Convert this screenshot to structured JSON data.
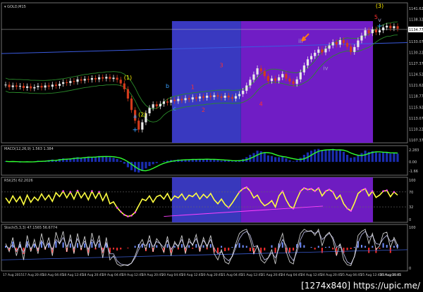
{
  "window": {
    "symbol_label": "GOLD,M15"
  },
  "colors": {
    "bg": "#000000",
    "border": "#8a8a8a",
    "bull": "#e8e8e8",
    "bear": "#d23a1c",
    "blue_zone": "#3e3ed0",
    "purple_zone": "#7a1fd6",
    "ma": "#2a8a2a",
    "trend": "#3b5be0",
    "macd_hist": "#1a2db0",
    "macd_line": "#30ff30",
    "rsi": "#ffff40",
    "rsi_dot": "#ff40ff",
    "stoch_blue": "#6f8cff",
    "stoch_red": "#ff3030",
    "axis_text": "#cfcfcf",
    "wave_yellow": "#ffee00",
    "wave_blue": "#3aa0ff",
    "wave_red": "#ff3030",
    "wave_grey": "#a0a0c8",
    "arrow": "#ff7a1a"
  },
  "chart_data": [
    {
      "type": "candlestick",
      "title": "GOLD,M15",
      "ylim": [
        1107.37,
        1141.62
      ],
      "y_ticks": [
        "1141.62",
        "1138.32",
        "1135.97",
        "1133.07",
        "1130.22",
        "1127.37",
        "1124.52",
        "1121.62",
        "1118.77",
        "1115.92",
        "1113.07",
        "1110.22",
        "1107.37"
      ],
      "current_price": "1134.77",
      "zones": [
        {
          "from_bar": 0.42,
          "to_bar": 0.59,
          "color": "blue"
        },
        {
          "from_bar": 0.59,
          "to_bar": 0.915,
          "color": "purple"
        }
      ],
      "close": [
        1121.6,
        1121.0,
        1121.4,
        1121.1,
        1121.3,
        1120.8,
        1121.2,
        1120.7,
        1121.0,
        1121.3,
        1120.9,
        1121.4,
        1121.1,
        1121.6,
        1121.3,
        1121.8,
        1122.2,
        1122.0,
        1122.5,
        1122.3,
        1122.9,
        1122.6,
        1123.0,
        1122.8,
        1123.2,
        1122.9,
        1123.4,
        1123.1,
        1123.5,
        1123.0,
        1123.3,
        1122.8,
        1121.9,
        1120.5,
        1118.2,
        1115.4,
        1112.8,
        1110.6,
        1112.4,
        1114.6,
        1115.9,
        1116.8,
        1116.3,
        1116.9,
        1117.5,
        1117.2,
        1117.9,
        1117.6,
        1118.1,
        1117.8,
        1118.3,
        1118.0,
        1118.5,
        1118.2,
        1118.7,
        1118.4,
        1118.9,
        1118.6,
        1119.0,
        1118.7,
        1118.4,
        1118.9,
        1118.5,
        1118.2,
        1118.8,
        1119.3,
        1120.1,
        1121.4,
        1122.8,
        1124.1,
        1125.6,
        1124.9,
        1123.7,
        1122.5,
        1123.1,
        1122.6,
        1123.4,
        1124.2,
        1123.1,
        1122.4,
        1121.8,
        1122.9,
        1124.6,
        1126.3,
        1127.8,
        1128.6,
        1129.4,
        1130.2,
        1129.5,
        1130.4,
        1131.2,
        1132.0,
        1131.4,
        1132.5,
        1131.8,
        1130.9,
        1129.6,
        1130.8,
        1132.4,
        1133.6,
        1134.9,
        1134.2,
        1135.1,
        1134.4,
        1134.9,
        1135.6,
        1136.0,
        1135.4,
        1135.9,
        1135.3
      ],
      "wave_labels": [
        {
          "text": "(1)",
          "color": "yellow",
          "bar": 34,
          "price": 1122.9
        },
        {
          "text": "(2)",
          "color": "yellow",
          "bar": 38,
          "price": 1113.8
        },
        {
          "text": "(3)",
          "color": "yellow",
          "bar": 104,
          "price": 1140.4
        },
        {
          "text": "a",
          "color": "blue",
          "bar": 36,
          "price": 1113.4
        },
        {
          "text": "b",
          "color": "blue",
          "bar": 45,
          "price": 1120.8
        },
        {
          "text": "c",
          "color": "blue",
          "bar": 47,
          "price": 1115.3
        },
        {
          "text": "1",
          "color": "red",
          "bar": 52,
          "price": 1120.5
        },
        {
          "text": "2",
          "color": "red",
          "bar": 55,
          "price": 1114.9
        },
        {
          "text": "3",
          "color": "red",
          "bar": 60,
          "price": 1125.9
        },
        {
          "text": "4",
          "color": "red",
          "bar": 71,
          "price": 1116.4
        },
        {
          "text": "5",
          "color": "red",
          "bar": 103,
          "price": 1137.7
        },
        {
          "text": "iii",
          "color": "grey",
          "bar": 82,
          "price": 1131.8
        },
        {
          "text": "iv",
          "color": "grey",
          "bar": 89,
          "price": 1125.2
        },
        {
          "text": "v",
          "color": "grey",
          "bar": 104,
          "price": 1137.0
        }
      ]
    },
    {
      "type": "macd",
      "title": "MACD(12,26,9) 1.563 1.384",
      "y_ticks": [
        "2.283",
        "0.00",
        "-1.66"
      ],
      "values": [
        0.1,
        0.0,
        0.1,
        0.0,
        -0.1,
        0.0,
        0.1,
        0.0,
        0.1,
        0.2,
        0.1,
        0.2,
        0.3,
        0.4,
        0.3,
        0.5,
        0.6,
        0.5,
        0.6,
        0.7,
        0.8,
        0.7,
        0.8,
        0.9,
        0.8,
        0.9,
        1.0,
        0.9,
        1.0,
        0.8,
        0.7,
        0.5,
        0.2,
        -0.3,
        -0.9,
        -1.4,
        -1.7,
        -1.8,
        -1.5,
        -1.1,
        -0.7,
        -0.4,
        -0.2,
        0.0,
        0.1,
        0.2,
        0.3,
        0.3,
        0.4,
        0.4,
        0.4,
        0.4,
        0.5,
        0.4,
        0.5,
        0.4,
        0.5,
        0.4,
        0.4,
        0.3,
        0.2,
        0.3,
        0.2,
        0.1,
        0.2,
        0.3,
        0.5,
        0.8,
        1.2,
        1.5,
        1.9,
        1.8,
        1.5,
        1.1,
        1.0,
        0.8,
        0.8,
        0.9,
        0.6,
        0.3,
        0.1,
        0.3,
        0.7,
        1.2,
        1.6,
        1.9,
        2.1,
        2.2,
        1.9,
        2.0,
        2.1,
        2.2,
        1.9,
        2.0,
        1.7,
        1.2,
        0.7,
        0.8,
        1.2,
        1.5,
        1.9,
        1.7,
        1.8,
        1.6,
        1.5,
        1.6,
        1.6,
        1.4,
        1.5,
        1.4
      ]
    },
    {
      "type": "rsi",
      "title": "RSI(25) 62.2026",
      "y_ticks": [
        "100",
        "70",
        "32",
        "0"
      ],
      "values": [
        55,
        42,
        60,
        45,
        58,
        38,
        62,
        44,
        57,
        48,
        65,
        50,
        62,
        46,
        68,
        58,
        72,
        55,
        70,
        52,
        73,
        55,
        68,
        50,
        72,
        54,
        70,
        48,
        66,
        40,
        45,
        30,
        20,
        12,
        8,
        10,
        18,
        35,
        52,
        48,
        60,
        44,
        58,
        62,
        52,
        66,
        48,
        60,
        55,
        65,
        50,
        62,
        58,
        67,
        52,
        64,
        55,
        66,
        50,
        40,
        52,
        38,
        30,
        42,
        56,
        70,
        78,
        82,
        72,
        55,
        62,
        45,
        35,
        40,
        48,
        32,
        60,
        72,
        50,
        34,
        28,
        52,
        72,
        80,
        76,
        78,
        72,
        80,
        60,
        72,
        76,
        70,
        52,
        62,
        40,
        28,
        22,
        42,
        66,
        74,
        78,
        60,
        72,
        56,
        62,
        72,
        74,
        58,
        70,
        62
      ]
    },
    {
      "type": "stochastic",
      "title": "Stoch(5,3,3) 47.1565 56.6774",
      "y_ticks": [
        "100",
        "0"
      ],
      "k": [
        60,
        40,
        75,
        30,
        65,
        20,
        80,
        40,
        70,
        35,
        85,
        45,
        75,
        30,
        88,
        60,
        90,
        40,
        82,
        35,
        85,
        45,
        78,
        30,
        86,
        50,
        80,
        25,
        75,
        20,
        30,
        10,
        5,
        8,
        6,
        12,
        30,
        55,
        70,
        45,
        80,
        40,
        72,
        60,
        38,
        78,
        30,
        65,
        50,
        80,
        35,
        72,
        55,
        82,
        40,
        75,
        50,
        80,
        35,
        20,
        45,
        15,
        10,
        30,
        60,
        85,
        92,
        95,
        70,
        35,
        55,
        20,
        12,
        25,
        45,
        10,
        60,
        85,
        40,
        15,
        10,
        50,
        85,
        95,
        90,
        92,
        80,
        95,
        55,
        80,
        88,
        70,
        30,
        60,
        20,
        8,
        6,
        30,
        80,
        90,
        95,
        60,
        85,
        45,
        55,
        85,
        88,
        50,
        75,
        56
      ],
      "d": [
        55,
        48,
        58,
        42,
        55,
        38,
        62,
        48,
        60,
        45,
        68,
        50,
        62,
        45,
        70,
        60,
        75,
        52,
        70,
        48,
        72,
        52,
        66,
        45,
        70,
        55,
        68,
        40,
        62,
        35,
        35,
        18,
        10,
        8,
        8,
        12,
        25,
        45,
        60,
        55,
        68,
        52,
        65,
        60,
        50,
        68,
        45,
        60,
        55,
        70,
        48,
        65,
        58,
        72,
        50,
        68,
        55,
        70,
        48,
        35,
        40,
        25,
        18,
        28,
        50,
        72,
        85,
        90,
        80,
        52,
        55,
        35,
        20,
        25,
        38,
        25,
        48,
        70,
        55,
        30,
        18,
        40,
        70,
        88,
        90,
        90,
        85,
        90,
        70,
        78,
        85,
        75,
        50,
        58,
        35,
        15,
        10,
        28,
        62,
        82,
        90,
        75,
        80,
        60,
        58,
        72,
        80,
        65,
        70,
        47
      ]
    }
  ],
  "x_axis_labels": [
    "17 Aug 2015",
    "17 Aug 20:45",
    "18 Aug 04:45",
    "18 Aug 12:45",
    "18 Aug 20:45",
    "19 Aug 04:45",
    "19 Aug 12:45",
    "19 Aug 20:45",
    "20 Aug 04:45",
    "20 Aug 12:45",
    "20 Aug 20:45",
    "21 Aug 04:45",
    "21 Aug 12:45",
    "21 Aug 20:45",
    "24 Aug 04:45",
    "24 Aug 12:45",
    "24 Aug 20:45",
    "25 Aug 04:45",
    "25 Aug 12:45",
    "25 Aug 20:45",
    "26 Aug 04:45"
  ],
  "watermark": "[1274x840] https://upic.me/"
}
